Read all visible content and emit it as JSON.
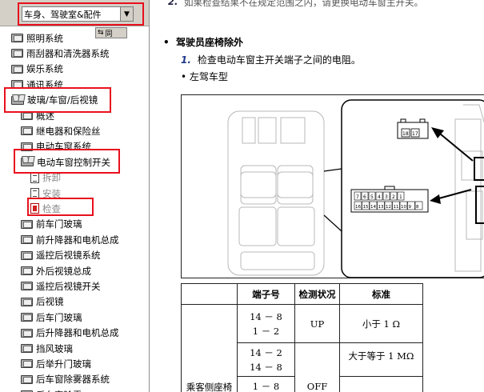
{
  "nav": {
    "category": "车身、驾驶室&配件",
    "tools": [
      "⇆",
      "同"
    ],
    "items": [
      {
        "label": "照明系统",
        "level": 0,
        "icon": "book-icon",
        "state": "normal"
      },
      {
        "label": "雨刮器和清洗器系统",
        "level": 0,
        "icon": "book-icon",
        "state": "normal"
      },
      {
        "label": "娱乐系统",
        "level": 0,
        "icon": "book-icon",
        "state": "normal"
      },
      {
        "label": "通讯系统",
        "level": 0,
        "icon": "book-icon",
        "state": "normal"
      },
      {
        "label": "玻璃/车窗/后视镜",
        "level": 0,
        "icon": "book-open-icon",
        "state": "open"
      },
      {
        "label": "概述",
        "level": 1,
        "icon": "book-icon",
        "state": "normal"
      },
      {
        "label": "继电器和保险丝",
        "level": 1,
        "icon": "book-icon",
        "state": "normal"
      },
      {
        "label": "电动车窗系统",
        "level": 1,
        "icon": "book-icon",
        "state": "normal"
      },
      {
        "label": "电动车窗控制开关",
        "level": 1,
        "icon": "book-open-icon",
        "state": "open"
      },
      {
        "label": "拆卸",
        "level": 2,
        "icon": "doc-icon",
        "state": "disabled"
      },
      {
        "label": "安装",
        "level": 2,
        "icon": "doc-icon",
        "state": "disabled"
      },
      {
        "label": "检查",
        "level": 2,
        "icon": "doc-active-icon",
        "state": "disabled"
      },
      {
        "label": "前车门玻璃",
        "level": 1,
        "icon": "book-icon",
        "state": "normal"
      },
      {
        "label": "前升降器和电机总成",
        "level": 1,
        "icon": "book-icon",
        "state": "normal"
      },
      {
        "label": "遥控后视镜系统",
        "level": 1,
        "icon": "book-icon",
        "state": "normal"
      },
      {
        "label": "外后视镜总成",
        "level": 1,
        "icon": "book-icon",
        "state": "normal"
      },
      {
        "label": "遥控后视镜开关",
        "level": 1,
        "icon": "book-icon",
        "state": "normal"
      },
      {
        "label": "后视镜",
        "level": 1,
        "icon": "book-icon",
        "state": "normal"
      },
      {
        "label": "后车门玻璃",
        "level": 1,
        "icon": "book-icon",
        "state": "normal"
      },
      {
        "label": "后升降器和电机总成",
        "level": 1,
        "icon": "book-icon",
        "state": "normal"
      },
      {
        "label": "挡风玻璃",
        "level": 1,
        "icon": "book-icon",
        "state": "normal"
      },
      {
        "label": "后举升门玻璃",
        "level": 1,
        "icon": "book-icon",
        "state": "normal"
      },
      {
        "label": "后车窗除雾器系统",
        "level": 1,
        "icon": "book-icon",
        "state": "normal"
      },
      {
        "label": "后车窗除雾",
        "level": 1,
        "icon": "book-icon",
        "state": "normal"
      }
    ]
  },
  "content": {
    "prev_step_num": "2.",
    "prev_step_text": "如果检查结果不在规定范围之内，请更换电动车窗主开关。",
    "section_heading": "驾驶员座椅除外",
    "step_num": "1.",
    "step_text": "检查电动车窗主开关端子之间的电阻。",
    "sub_bullet": "左驾车型",
    "connector_small_labels": [
      "18",
      "17"
    ],
    "connector_big_top": [
      "7",
      "6",
      "5",
      "4",
      "3",
      "2",
      "1"
    ],
    "connector_big_bottom": [
      "16",
      "15",
      "14",
      "13",
      "12",
      "11",
      "10",
      "9",
      "8"
    ],
    "table": {
      "headers": [
        "",
        "端子号",
        "检测状况",
        "标准"
      ],
      "row_group_label": "乘客侧座椅",
      "rows": [
        {
          "pins": [
            "14 － 8",
            "1 － 2"
          ],
          "condition": "UP",
          "standard": "小于 1 Ω"
        },
        {
          "pins": [
            "14 － 2",
            "14 － 8"
          ],
          "condition": "",
          "standard": "大于等于 1 MΩ"
        },
        {
          "pins": [
            "1 － 8"
          ],
          "condition": "OFF",
          "standard": ""
        }
      ]
    },
    "colors": {
      "highlight": "#e8101c",
      "arrow": "#000000",
      "step_number": "#1f3a8a"
    }
  }
}
